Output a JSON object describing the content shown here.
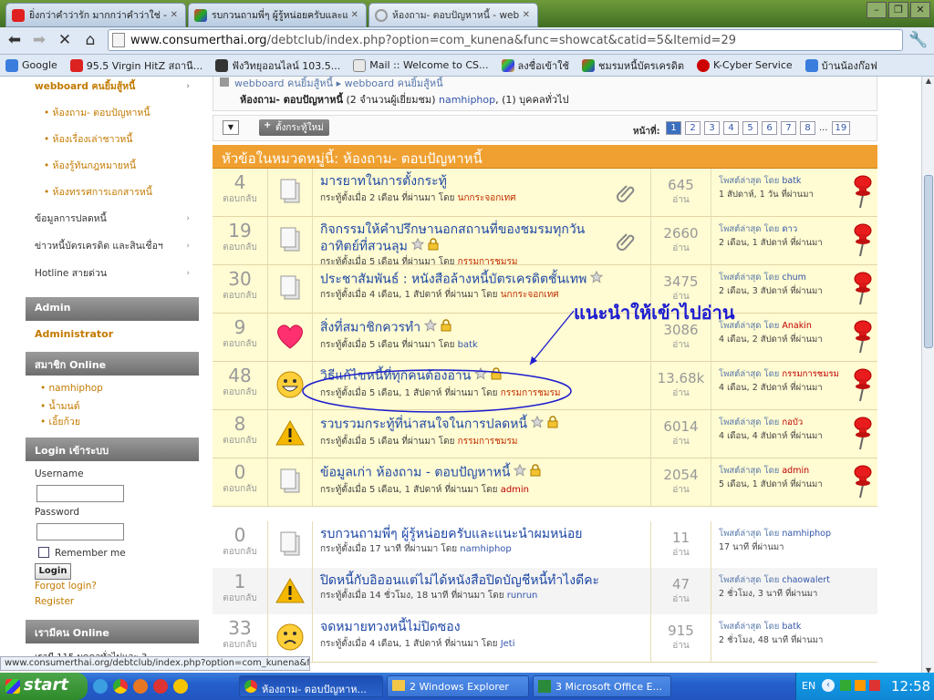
{
  "browser": {
    "tabs": [
      {
        "title": "ยิ่งกว่าคำว่ารัก มากกว่าคำว่าใช่ -"
      },
      {
        "title": "รบกวนถามพี่ๆ ผู้รู้หน่อยครับและแน"
      },
      {
        "title": "ห้องถาม- ตอบปัญหาหนี้ - webb"
      }
    ],
    "url_host": "www.consumerthai.org",
    "url_path": "/debtclub/index.php?option=com_kunena&func=showcat&catid=5&Itemid=29",
    "bookmarks": [
      "Google",
      "95.5 Virgin HitZ สถานี...",
      "ฟังวิทยุออนไลน์ 103.5...",
      "Mail :: Welcome to CS...",
      "ลงชื่อเข้าใช้",
      "ชมรมหนี้บัตรเครดิต",
      "K-Cyber Service",
      "บ้านน้องก๊อฟ"
    ]
  },
  "sidebar": {
    "top_link": "webboard คนยิ้มสู้หนี้",
    "sub_links": [
      "ห้องถาม- ตอบปัญหาหนี้",
      "ห้องเรื่องเล่าชาวหนี้",
      "ห้องรู้ทันกฎหมายหนี้",
      "ห้องทรรศการเอกสารหนี้"
    ],
    "links": [
      "ข้อมูลการปลดหนี้",
      "ข่าวหนี้บัตรเครดิต และสินเชื่อฯ",
      "Hotline สายด่วน"
    ],
    "admin_header": "Admin",
    "admin_link": "Administrator",
    "online_header": "สมาชิก Online",
    "online_users": [
      "namhiphop",
      "น้ำมนต์",
      "เอิ้ยก้วย"
    ],
    "login_header": "Login เข้าระบบ",
    "username_label": "Username",
    "password_label": "Password",
    "remember_label": "Remember me",
    "login_button": "Login",
    "forgot_link": "Forgot login?",
    "register_link": "Register",
    "guests_header": "เรามีคน Online",
    "guests_text": "เรามี 115 บุคคลทั่วไปและ 3"
  },
  "main": {
    "breadcrumb_top": "webboard คนยิ้มสู้หนี้ ▸ webboard คนยิ้มสู้หนี้",
    "breadcrumb_cat": "ห้องถาม- ตอบปัญหาหนี้",
    "breadcrumb_viewers": "(2 จำนวนผู้เยี่ยมชม)",
    "breadcrumb_user": "namhiphop",
    "breadcrumb_guests": ", (1) บุคคลทั่วไป",
    "new_topic_button": "ตั้งกระทู้ใหม่",
    "page_label": "หน้าที่:",
    "pages": [
      "1",
      "2",
      "3",
      "4",
      "5",
      "6",
      "7",
      "8",
      "...",
      "19"
    ],
    "category_title": "หัวข้อในหมวดหมู่นี้: ห้องถาม- ตอบปัญหาหนี้",
    "reply_label": "ตอบกลับ",
    "view_label": "อ่าน",
    "last_post_label": "โพสต์ล่าสุด โดย",
    "sticky_topics": [
      {
        "replies": "4",
        "icon": "document-icon",
        "title": "มารยาทในการตั้งกระทู้",
        "meta": "กระทู้ตั้งเมื่อ 2 เดือน ที่ผ่านมา โดย",
        "author": "นกกระจอกเทศ",
        "views": "645",
        "last_by": "batk",
        "last_time": "1 สัปดาห์, 1 วัน ที่ผ่านมา",
        "attach": true,
        "star": false,
        "lock": false
      },
      {
        "replies": "19",
        "icon": "document-icon",
        "title": "กิจกรรมให้คำปรึกษานอกสถานที่ของชมรมทุกวันอาทิตย์ที่สวนลุม",
        "meta": "กระทู้ตั้งเมื่อ 5 เดือน ที่ผ่านมา โดย",
        "author": "กรรมการชมรม",
        "views": "2660",
        "last_by": "ดาว",
        "last_time": "2 เดือน, 1 สัปดาห์ ที่ผ่านมา",
        "attach": true,
        "star": true,
        "lock": true
      },
      {
        "replies": "30",
        "icon": "document-icon",
        "title": "ประชาสัมพันธ์ : หนังสือล้างหนี้บัตรเครดิตชั้นเทพ",
        "meta": "กระทู้ตั้งเมื่อ 4 เดือน, 1 สัปดาห์ ที่ผ่านมา โดย",
        "author": "นกกระจอกเทศ",
        "views": "3475",
        "last_by": "chum",
        "last_time": "2 เดือน, 3 สัปดาห์ ที่ผ่านมา",
        "attach": false,
        "star": true,
        "lock": false
      },
      {
        "replies": "9",
        "icon": "heart-icon",
        "title": "สิ่งที่สมาชิกควรทำ",
        "meta": "กระทู้ตั้งเมื่อ 5 เดือน ที่ผ่านมา โดย",
        "author": "batk",
        "views": "3086",
        "last_by": "Anakin",
        "last_time": "4 เดือน, 2 สัปดาห์ ที่ผ่านมา",
        "attach": false,
        "star": true,
        "lock": true
      },
      {
        "replies": "48",
        "icon": "grin-face-icon",
        "title": "วิธีแก้ไขหนี้ที่ทุกคนต้องอ่าน",
        "meta": "กระทู้ตั้งเมื่อ 5 เดือน, 1 สัปดาห์ ที่ผ่านมา โดย",
        "author": "กรรมการชมรม",
        "views": "13.68k",
        "last_by": "กรรมการชมรม",
        "last_time": "4 เดือน, 2 สัปดาห์ ที่ผ่านมา",
        "attach": false,
        "star": true,
        "lock": true
      },
      {
        "replies": "8",
        "icon": "warning-icon",
        "title": "รวบรวมกระทู้ที่น่าสนใจในการปลดหนี้",
        "meta": "กระทู้ตั้งเมื่อ 5 เดือน ที่ผ่านมา โดย",
        "author": "กรรมการชมรม",
        "views": "6014",
        "last_by": "กอบัว",
        "last_time": "4 เดือน, 4 สัปดาห์ ที่ผ่านมา",
        "attach": false,
        "star": true,
        "lock": true
      },
      {
        "replies": "0",
        "icon": "document-icon",
        "title": "ข้อมูลเก่า ห้องถาม - ตอบปัญหาหนี้",
        "meta": "กระทู้ตั้งเมื่อ 5 เดือน, 1 สัปดาห์ ที่ผ่านมา โดย",
        "author": "admin",
        "views": "2054",
        "last_by": "admin",
        "last_time": "5 เดือน, 1 สัปดาห์ ที่ผ่านมา",
        "attach": false,
        "star": true,
        "lock": true
      }
    ],
    "topics": [
      {
        "replies": "0",
        "icon": "document-icon",
        "title": "รบกวนถามพี่ๆ ผู้รู้หน่อยครับและแนะนำผมหน่อย",
        "meta": "กระทู้ตั้งเมื่อ 17 นาที ที่ผ่านมา โดย",
        "author": "namhiphop",
        "views": "11",
        "last_by": "namhiphop",
        "last_time": "17 นาที ที่ผ่านมา"
      },
      {
        "replies": "1",
        "icon": "warning-icon",
        "title": "ปิดหนี้กับอิออนแต่ไม่ได้หนังสือปิดบัญชีหนี้ทำไงดีคะ",
        "meta": "กระทู้ตั้งเมื่อ 14 ชั่วโมง, 18 นาที ที่ผ่านมา โดย",
        "author": "runrun",
        "views": "47",
        "last_by": "chaowalert",
        "last_time": "2 ชั่วโมง, 3 นาที ที่ผ่านมา"
      },
      {
        "replies": "33",
        "icon": "frown-face-icon",
        "title": "จดหมายทวงหนี้ไม่ปิดซอง",
        "meta": "กระทู้ตั้งเมื่อ 4 เดือน, 1 สัปดาห์ ที่ผ่านมา โดย",
        "author": "Jeti",
        "views": "915",
        "last_by": "batk",
        "last_time": "2 ชั่วโมง, 48 นาที ที่ผ่านมา"
      }
    ],
    "annotation": "แนะนำให้เข้าไปอ่าน"
  },
  "status_url": "www.consumerthai.org/debtclub/index.php?option=com_kunena&f...",
  "taskbar": {
    "start": "start",
    "items": [
      "ห้องถาม- ตอบปัญหาห...",
      "2 Windows Explorer",
      "3 Microsoft Office E..."
    ],
    "lang": "EN",
    "clock": "12:58"
  },
  "colors": {
    "category_bar": "#f0a030",
    "sticky_row": "#fffbd2",
    "link_blue": "#1e48a5",
    "annotation": "#1c1cd0"
  }
}
